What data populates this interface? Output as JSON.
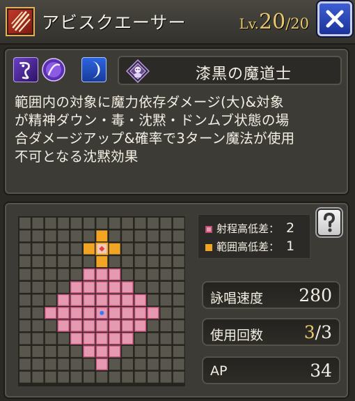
{
  "header": {
    "skill_icon": "slash-claw-icon",
    "title": "アビスクエーサー",
    "level_prefix": "Lv.",
    "level_current": "20",
    "level_max": "/20",
    "close_icon": "close-icon"
  },
  "info": {
    "element_icons": [
      "shadow-swirl-icon",
      "dark-orb-icon",
      "crescent-moon-icon"
    ],
    "class_emblem": "dark-mage-emblem-icon",
    "class_name": "漆黒の魔道士",
    "description_lines": [
      "範囲内の対象に魔力依存ダメージ(大)&対象",
      "が精神ダウン・毒・沈黙・ドンムブ状態の場",
      "合ダメージアップ&確率で3ターン魔法が使用",
      "不可となる沈黙効果"
    ]
  },
  "range": {
    "grid": {
      "size": 13,
      "range_color": "#e59ab1",
      "range_border": "#c04f78",
      "area_color": "#f2a523",
      "center_color": "#2f7bff",
      "target_color": "#e0423c",
      "range_cells": [
        [
          6,
          3
        ],
        [
          5,
          4
        ],
        [
          6,
          4
        ],
        [
          7,
          4
        ],
        [
          4,
          5
        ],
        [
          5,
          5
        ],
        [
          6,
          5
        ],
        [
          7,
          5
        ],
        [
          8,
          5
        ],
        [
          3,
          6
        ],
        [
          4,
          6
        ],
        [
          5,
          6
        ],
        [
          6,
          6
        ],
        [
          7,
          6
        ],
        [
          8,
          6
        ],
        [
          9,
          6
        ],
        [
          2,
          7
        ],
        [
          3,
          7
        ],
        [
          4,
          7
        ],
        [
          5,
          7
        ],
        [
          6,
          7
        ],
        [
          7,
          7
        ],
        [
          8,
          7
        ],
        [
          9,
          7
        ],
        [
          10,
          7
        ],
        [
          3,
          8
        ],
        [
          4,
          8
        ],
        [
          5,
          8
        ],
        [
          6,
          8
        ],
        [
          7,
          8
        ],
        [
          8,
          8
        ],
        [
          9,
          8
        ],
        [
          4,
          9
        ],
        [
          5,
          9
        ],
        [
          6,
          9
        ],
        [
          7,
          9
        ],
        [
          8,
          9
        ],
        [
          5,
          10
        ],
        [
          6,
          10
        ],
        [
          7,
          10
        ],
        [
          6,
          11
        ]
      ],
      "area_cells": [
        [
          6,
          1
        ],
        [
          5,
          2
        ],
        [
          7,
          2
        ],
        [
          6,
          3
        ]
      ],
      "target_cell": [
        6,
        2
      ],
      "center_cell": [
        6,
        7
      ]
    },
    "legend": {
      "range_label": "射程高低差：",
      "range_value": "2",
      "area_label": "範囲高低差：",
      "area_value": "1"
    },
    "help_icon": "question-mark-icon",
    "stats": {
      "cast_label": "詠唱速度",
      "cast_value": "280",
      "uses_label": "使用回数",
      "uses_current": "3",
      "uses_max": "/3",
      "ap_label": "AP",
      "ap_value": "34"
    }
  }
}
